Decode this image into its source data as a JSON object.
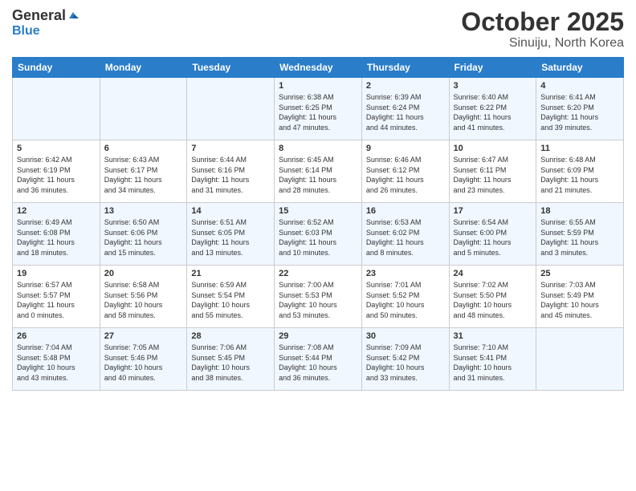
{
  "header": {
    "logo_line1": "General",
    "logo_line2": "Blue",
    "title": "October 2025",
    "subtitle": "Sinuiju, North Korea"
  },
  "weekdays": [
    "Sunday",
    "Monday",
    "Tuesday",
    "Wednesday",
    "Thursday",
    "Friday",
    "Saturday"
  ],
  "weeks": [
    [
      {
        "day": "",
        "info": ""
      },
      {
        "day": "",
        "info": ""
      },
      {
        "day": "",
        "info": ""
      },
      {
        "day": "1",
        "info": "Sunrise: 6:38 AM\nSunset: 6:25 PM\nDaylight: 11 hours\nand 47 minutes."
      },
      {
        "day": "2",
        "info": "Sunrise: 6:39 AM\nSunset: 6:24 PM\nDaylight: 11 hours\nand 44 minutes."
      },
      {
        "day": "3",
        "info": "Sunrise: 6:40 AM\nSunset: 6:22 PM\nDaylight: 11 hours\nand 41 minutes."
      },
      {
        "day": "4",
        "info": "Sunrise: 6:41 AM\nSunset: 6:20 PM\nDaylight: 11 hours\nand 39 minutes."
      }
    ],
    [
      {
        "day": "5",
        "info": "Sunrise: 6:42 AM\nSunset: 6:19 PM\nDaylight: 11 hours\nand 36 minutes."
      },
      {
        "day": "6",
        "info": "Sunrise: 6:43 AM\nSunset: 6:17 PM\nDaylight: 11 hours\nand 34 minutes."
      },
      {
        "day": "7",
        "info": "Sunrise: 6:44 AM\nSunset: 6:16 PM\nDaylight: 11 hours\nand 31 minutes."
      },
      {
        "day": "8",
        "info": "Sunrise: 6:45 AM\nSunset: 6:14 PM\nDaylight: 11 hours\nand 28 minutes."
      },
      {
        "day": "9",
        "info": "Sunrise: 6:46 AM\nSunset: 6:12 PM\nDaylight: 11 hours\nand 26 minutes."
      },
      {
        "day": "10",
        "info": "Sunrise: 6:47 AM\nSunset: 6:11 PM\nDaylight: 11 hours\nand 23 minutes."
      },
      {
        "day": "11",
        "info": "Sunrise: 6:48 AM\nSunset: 6:09 PM\nDaylight: 11 hours\nand 21 minutes."
      }
    ],
    [
      {
        "day": "12",
        "info": "Sunrise: 6:49 AM\nSunset: 6:08 PM\nDaylight: 11 hours\nand 18 minutes."
      },
      {
        "day": "13",
        "info": "Sunrise: 6:50 AM\nSunset: 6:06 PM\nDaylight: 11 hours\nand 15 minutes."
      },
      {
        "day": "14",
        "info": "Sunrise: 6:51 AM\nSunset: 6:05 PM\nDaylight: 11 hours\nand 13 minutes."
      },
      {
        "day": "15",
        "info": "Sunrise: 6:52 AM\nSunset: 6:03 PM\nDaylight: 11 hours\nand 10 minutes."
      },
      {
        "day": "16",
        "info": "Sunrise: 6:53 AM\nSunset: 6:02 PM\nDaylight: 11 hours\nand 8 minutes."
      },
      {
        "day": "17",
        "info": "Sunrise: 6:54 AM\nSunset: 6:00 PM\nDaylight: 11 hours\nand 5 minutes."
      },
      {
        "day": "18",
        "info": "Sunrise: 6:55 AM\nSunset: 5:59 PM\nDaylight: 11 hours\nand 3 minutes."
      }
    ],
    [
      {
        "day": "19",
        "info": "Sunrise: 6:57 AM\nSunset: 5:57 PM\nDaylight: 11 hours\nand 0 minutes."
      },
      {
        "day": "20",
        "info": "Sunrise: 6:58 AM\nSunset: 5:56 PM\nDaylight: 10 hours\nand 58 minutes."
      },
      {
        "day": "21",
        "info": "Sunrise: 6:59 AM\nSunset: 5:54 PM\nDaylight: 10 hours\nand 55 minutes."
      },
      {
        "day": "22",
        "info": "Sunrise: 7:00 AM\nSunset: 5:53 PM\nDaylight: 10 hours\nand 53 minutes."
      },
      {
        "day": "23",
        "info": "Sunrise: 7:01 AM\nSunset: 5:52 PM\nDaylight: 10 hours\nand 50 minutes."
      },
      {
        "day": "24",
        "info": "Sunrise: 7:02 AM\nSunset: 5:50 PM\nDaylight: 10 hours\nand 48 minutes."
      },
      {
        "day": "25",
        "info": "Sunrise: 7:03 AM\nSunset: 5:49 PM\nDaylight: 10 hours\nand 45 minutes."
      }
    ],
    [
      {
        "day": "26",
        "info": "Sunrise: 7:04 AM\nSunset: 5:48 PM\nDaylight: 10 hours\nand 43 minutes."
      },
      {
        "day": "27",
        "info": "Sunrise: 7:05 AM\nSunset: 5:46 PM\nDaylight: 10 hours\nand 40 minutes."
      },
      {
        "day": "28",
        "info": "Sunrise: 7:06 AM\nSunset: 5:45 PM\nDaylight: 10 hours\nand 38 minutes."
      },
      {
        "day": "29",
        "info": "Sunrise: 7:08 AM\nSunset: 5:44 PM\nDaylight: 10 hours\nand 36 minutes."
      },
      {
        "day": "30",
        "info": "Sunrise: 7:09 AM\nSunset: 5:42 PM\nDaylight: 10 hours\nand 33 minutes."
      },
      {
        "day": "31",
        "info": "Sunrise: 7:10 AM\nSunset: 5:41 PM\nDaylight: 10 hours\nand 31 minutes."
      },
      {
        "day": "",
        "info": ""
      }
    ]
  ]
}
